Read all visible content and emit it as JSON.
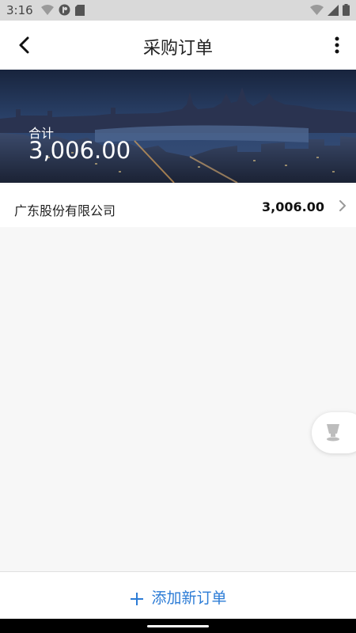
{
  "status_bar": {
    "time": "3:16",
    "icons": [
      "wifi-icon",
      "shield-icon",
      "sd-card-icon",
      "wifi-icon",
      "signal-icon",
      "battery-icon"
    ]
  },
  "header": {
    "title": "采购订单",
    "back_icon": "chevron-left-icon",
    "menu_icon": "more-vertical-icon"
  },
  "summary": {
    "label": "合计",
    "total": "3,006.00"
  },
  "orders": [
    {
      "company": "广东股份有限公司",
      "amount": "3,006.00"
    }
  ],
  "footer": {
    "add_label": "添加新订单"
  },
  "colors": {
    "accent": "#2c7cd6",
    "status_bar": "#d9d9d9",
    "background": "#f7f7f7"
  }
}
